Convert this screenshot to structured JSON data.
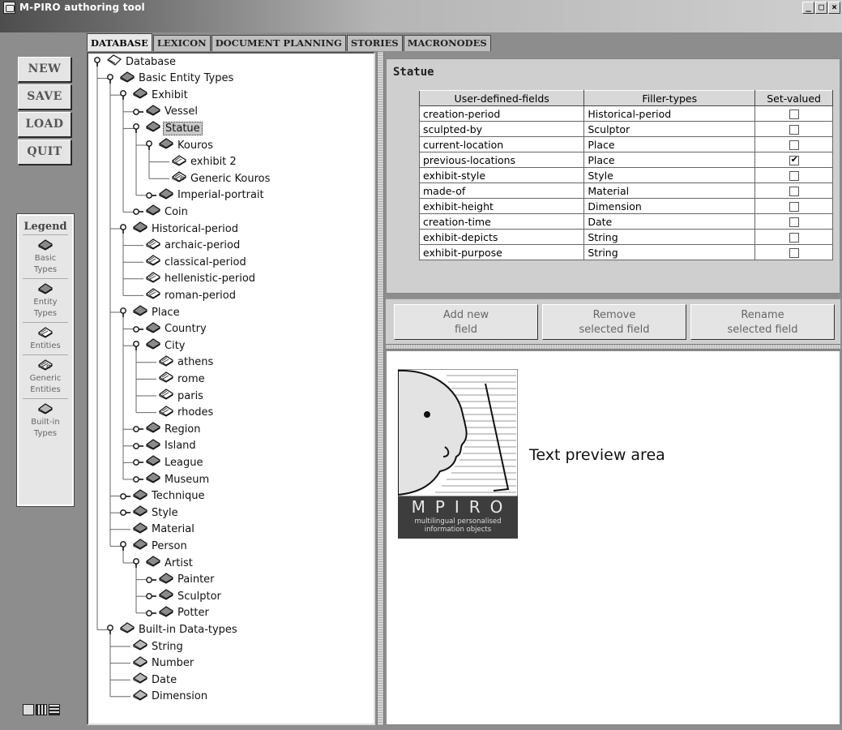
{
  "window": {
    "title": "M-PIRO authoring tool",
    "minimize": "_",
    "maximize": "□",
    "close": "×"
  },
  "tabs": [
    {
      "label": "DATABASE",
      "active": true
    },
    {
      "label": "LEXICON",
      "active": false
    },
    {
      "label": "DOCUMENT PLANNING",
      "active": false
    },
    {
      "label": "STORIES",
      "active": false
    },
    {
      "label": "MACRONODES",
      "active": false
    }
  ],
  "commands": {
    "new": "NEW",
    "save": "SAVE",
    "load": "LOAD",
    "quit": "QUIT"
  },
  "legend": {
    "title": "Legend",
    "items": [
      {
        "line1": "Basic",
        "line2": "Types",
        "icon": "basic-type-icon"
      },
      {
        "line1": "Entity",
        "line2": "Types",
        "icon": "entity-type-icon"
      },
      {
        "line1": "Entities",
        "line2": "",
        "icon": "entity-icon"
      },
      {
        "line1": "Generic",
        "line2": "Entities",
        "icon": "generic-entity-icon"
      },
      {
        "line1": "Built-in",
        "line2": "Types",
        "icon": "builtin-type-icon"
      }
    ]
  },
  "tree": [
    {
      "label": "Database",
      "depth": 0,
      "handle": "expanded",
      "icon": "database"
    },
    {
      "label": "Basic Entity Types",
      "depth": 1,
      "handle": "expanded",
      "icon": "type"
    },
    {
      "label": "Exhibit",
      "depth": 2,
      "handle": "expanded",
      "icon": "type"
    },
    {
      "label": "Vessel",
      "depth": 3,
      "handle": "collapsed",
      "icon": "type"
    },
    {
      "label": "Statue",
      "depth": 3,
      "handle": "expanded",
      "icon": "type",
      "selected": true
    },
    {
      "label": "Kouros",
      "depth": 4,
      "handle": "expanded",
      "icon": "type"
    },
    {
      "label": "exhibit 2",
      "depth": 5,
      "handle": "none",
      "icon": "entity"
    },
    {
      "label": "Generic Kouros",
      "depth": 5,
      "handle": "none",
      "icon": "generic"
    },
    {
      "label": "Imperial-portrait",
      "depth": 4,
      "handle": "collapsed",
      "icon": "type"
    },
    {
      "label": "Coin",
      "depth": 3,
      "handle": "collapsed",
      "icon": "type"
    },
    {
      "label": "Historical-period",
      "depth": 2,
      "handle": "expanded",
      "icon": "type"
    },
    {
      "label": "archaic-period",
      "depth": 3,
      "handle": "none",
      "icon": "entity"
    },
    {
      "label": "classical-period",
      "depth": 3,
      "handle": "none",
      "icon": "entity"
    },
    {
      "label": "hellenistic-period",
      "depth": 3,
      "handle": "none",
      "icon": "entity"
    },
    {
      "label": "roman-period",
      "depth": 3,
      "handle": "none",
      "icon": "entity"
    },
    {
      "label": "Place",
      "depth": 2,
      "handle": "expanded",
      "icon": "type"
    },
    {
      "label": "Country",
      "depth": 3,
      "handle": "collapsed",
      "icon": "type"
    },
    {
      "label": "City",
      "depth": 3,
      "handle": "expanded",
      "icon": "type"
    },
    {
      "label": "athens",
      "depth": 4,
      "handle": "none",
      "icon": "entity"
    },
    {
      "label": "rome",
      "depth": 4,
      "handle": "none",
      "icon": "entity"
    },
    {
      "label": "paris",
      "depth": 4,
      "handle": "none",
      "icon": "entity"
    },
    {
      "label": "rhodes",
      "depth": 4,
      "handle": "none",
      "icon": "entity"
    },
    {
      "label": "Region",
      "depth": 3,
      "handle": "collapsed",
      "icon": "type"
    },
    {
      "label": "Island",
      "depth": 3,
      "handle": "collapsed",
      "icon": "type"
    },
    {
      "label": "League",
      "depth": 3,
      "handle": "collapsed",
      "icon": "type"
    },
    {
      "label": "Museum",
      "depth": 3,
      "handle": "collapsed",
      "icon": "type"
    },
    {
      "label": "Technique",
      "depth": 2,
      "handle": "collapsed",
      "icon": "type"
    },
    {
      "label": "Style",
      "depth": 2,
      "handle": "collapsed",
      "icon": "type"
    },
    {
      "label": "Material",
      "depth": 2,
      "handle": "none",
      "icon": "type"
    },
    {
      "label": "Person",
      "depth": 2,
      "handle": "expanded",
      "icon": "type"
    },
    {
      "label": "Artist",
      "depth": 3,
      "handle": "expanded",
      "icon": "type"
    },
    {
      "label": "Painter",
      "depth": 4,
      "handle": "collapsed",
      "icon": "type"
    },
    {
      "label": "Sculptor",
      "depth": 4,
      "handle": "collapsed",
      "icon": "type"
    },
    {
      "label": "Potter",
      "depth": 4,
      "handle": "collapsed",
      "icon": "type"
    },
    {
      "label": "Built-in Data-types",
      "depth": 1,
      "handle": "expanded",
      "icon": "builtin"
    },
    {
      "label": "String",
      "depth": 2,
      "handle": "none",
      "icon": "builtin"
    },
    {
      "label": "Number",
      "depth": 2,
      "handle": "none",
      "icon": "builtin"
    },
    {
      "label": "Date",
      "depth": 2,
      "handle": "none",
      "icon": "builtin"
    },
    {
      "label": "Dimension",
      "depth": 2,
      "handle": "none",
      "icon": "builtin"
    }
  ],
  "properties": {
    "title": "Statue",
    "columns": [
      "User-defined-fields",
      "Filler-types",
      "Set-valued"
    ],
    "rows": [
      {
        "field": "creation-period",
        "filler": "Historical-period",
        "set_valued": false
      },
      {
        "field": "sculpted-by",
        "filler": "Sculptor",
        "set_valued": false
      },
      {
        "field": "current-location",
        "filler": "Place",
        "set_valued": false
      },
      {
        "field": "previous-locations",
        "filler": "Place",
        "set_valued": true
      },
      {
        "field": "exhibit-style",
        "filler": "Style",
        "set_valued": false
      },
      {
        "field": "made-of",
        "filler": "Material",
        "set_valued": false
      },
      {
        "field": "exhibit-height",
        "filler": "Dimension",
        "set_valued": false
      },
      {
        "field": "creation-time",
        "filler": "Date",
        "set_valued": false
      },
      {
        "field": "exhibit-depicts",
        "filler": "String",
        "set_valued": false
      },
      {
        "field": "exhibit-purpose",
        "filler": "String",
        "set_valued": false
      }
    ],
    "buttons": {
      "add": [
        "Add new",
        "field"
      ],
      "remove": [
        "Remove",
        "selected field"
      ],
      "rename": [
        "Rename",
        "selected field"
      ]
    }
  },
  "preview": {
    "text": "Text preview area",
    "logo_letters": "MPIRO",
    "logo_tagline_1": "multilingual personalised",
    "logo_tagline_2": "information objects"
  }
}
